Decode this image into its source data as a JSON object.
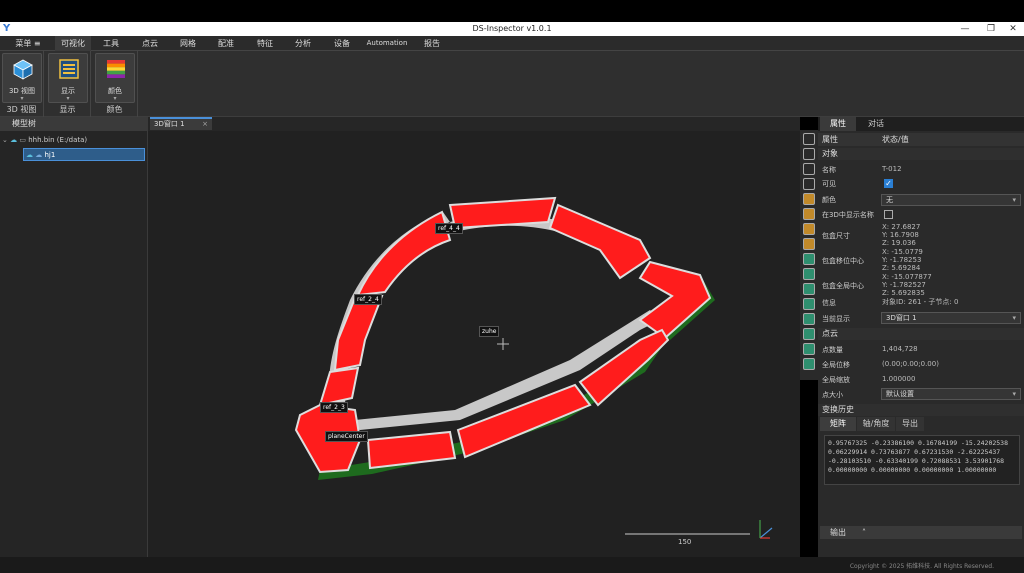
{
  "window": {
    "title": "DS-Inspector v1.0.1",
    "minimize": "—",
    "restore": "❐",
    "close": "✕",
    "logo": "Y"
  },
  "menu": {
    "main": "菜单 ≡",
    "items": [
      "可视化",
      "工具",
      "点云",
      "网格",
      "配准",
      "特征",
      "分析",
      "设备",
      "Automation",
      "报告"
    ]
  },
  "ribbon": {
    "view3d": {
      "label": "3D 视图",
      "group": "3D 视图"
    },
    "display": {
      "label": "显示",
      "group": "显示"
    },
    "color": {
      "label": "颜色",
      "group": "颜色"
    },
    "dropdown_glyph": "▾"
  },
  "tree": {
    "header": "模型树",
    "root": "hhh.bin (E:/data)",
    "child": "hj1"
  },
  "viewport": {
    "tab": "3D窗口 1",
    "tab_close": "×",
    "labels": [
      "ref_4_4",
      "ref_2_4",
      "ref_2_3",
      "planeCenter",
      "zuhe"
    ],
    "scale_value": "150"
  },
  "right": {
    "tabs": [
      "属性",
      "对话"
    ],
    "head_key": "属性",
    "head_val": "状态/值",
    "section_object": "对象",
    "name_k": "名称",
    "name_v": "T-012",
    "visible_k": "可见",
    "color_k": "颜色",
    "color_v": "无",
    "show_name_k": "在3D中显示名称",
    "bbox_size_k": "包盒尺寸",
    "bbox_size_v": "X: 27.6827\nY: 16.7908\nZ: 19.036",
    "bbox_local_k": "包盒移位中心",
    "bbox_local_v": "X: -15.0779\nY: -1.78253\nZ: 5.69284",
    "bbox_global_k": "包盒全局中心",
    "bbox_global_v": "X: -15.077877\nY: -1.782527\nZ: 5.692835",
    "info_k": "信息",
    "info_v": "对象ID: 261 - 子节点: 0",
    "current_display_k": "当前显示",
    "current_display_v": "3D窗口 1",
    "section_cloud": "点云",
    "points_k": "点数量",
    "points_v": "1,404,728",
    "shift_k": "全局位移",
    "shift_v": "(0.00;0.00;0.00)",
    "scale_k": "全局缩放",
    "scale_v": "1.000000",
    "point_size_k": "点大小",
    "point_size_v": "默认设置",
    "section_history": "变换历史",
    "subtabs": [
      "矩阵",
      "轴/角度",
      "导出"
    ],
    "matrix": "0.95767325 -0.23386100 0.16784199 -15.24202538\n0.06229914 0.73763877 0.67231530 -2.62225437\n-0.28103510 -0.63340199 0.72088531 3.53901768\n0.00000000 0.00000000 0.00000000 1.00000000",
    "output": "输出",
    "output_caret": "˄"
  },
  "status": {
    "copyright": "Copyright © 2025 拓维科技. All Rights Reserved."
  },
  "colors": {
    "accent": "#4a90d9",
    "part_red": "#ff1c1c",
    "part_green": "#2e8b2e"
  }
}
